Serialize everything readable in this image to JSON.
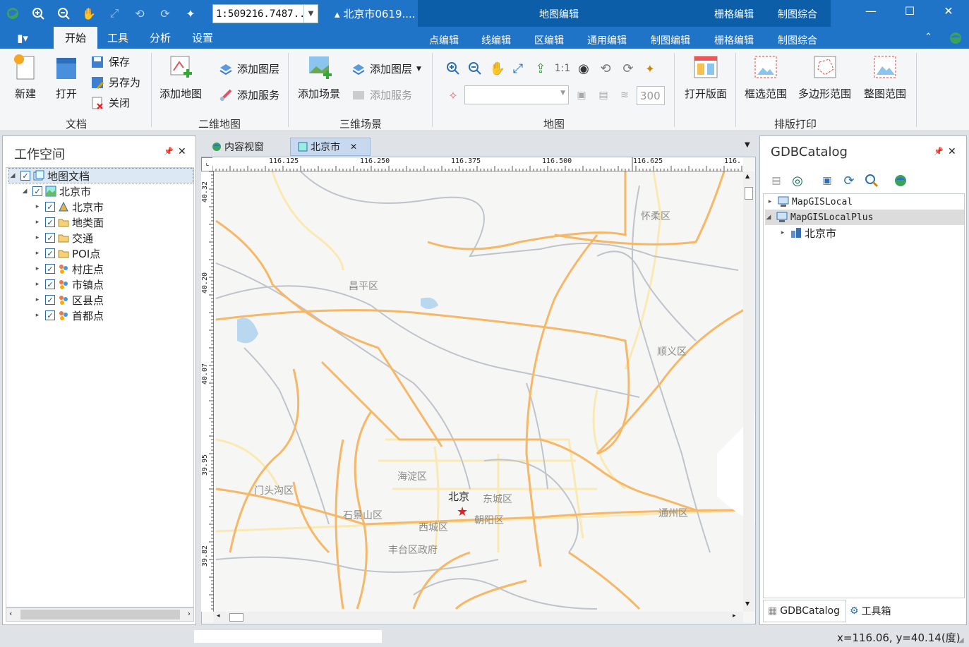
{
  "titlebar": {
    "scale_value": "1:509216.7487...",
    "doc_title": "北京市0619....",
    "ctx_title": "地图编辑",
    "ctx_right_top": [
      "栅格编辑",
      "制图综合"
    ],
    "ctx_tabs": [
      "点编辑",
      "线编辑",
      "区编辑",
      "通用编辑",
      "制图编辑",
      "栅格编辑",
      "制图综合"
    ]
  },
  "tabs": [
    "开始",
    "工具",
    "分析",
    "设置"
  ],
  "ribbon": {
    "doc": {
      "new": "新建",
      "open": "打开",
      "save": "保存",
      "save_as": "另存为",
      "close": "关闭",
      "group": "文档"
    },
    "map2d": {
      "add_map": "添加地图",
      "add_layer": "添加图层",
      "add_service": "添加服务",
      "group": "二维地图"
    },
    "scene3d": {
      "add_scene": "添加场景",
      "add_layer": "添加图层",
      "add_service": "添加服务",
      "group": "三维场景"
    },
    "map": {
      "ratio_label": "1:1",
      "opacity_value": "300",
      "group": "地图"
    },
    "print": {
      "open_layout": "打开版面",
      "box_range": "框选范围",
      "polygon_range": "多边形范围",
      "full_range": "整图范围",
      "group": "排版打印"
    }
  },
  "workspace": {
    "title": "工作空间",
    "root": "地图文档",
    "map": "北京市",
    "layers": [
      "北京市",
      "地类面",
      "交通",
      "POI点",
      "村庄点",
      "市镇点",
      "区县点",
      "首都点"
    ]
  },
  "map_view": {
    "tabs": [
      "内容视窗",
      "北京市"
    ],
    "ruler_top": [
      "116.125",
      "116.250",
      "116.375",
      "116.500",
      "116.625",
      "116."
    ],
    "ruler_left": [
      "40.32",
      "40.20",
      "40.07",
      "39.95",
      "39.82"
    ],
    "labels": {
      "huairou": "怀柔区",
      "changping": "昌平区",
      "shunyi": "顺义区",
      "haidian": "海淀区",
      "mentougou": "门头沟区",
      "beijing": "北京",
      "dongcheng": "东城区",
      "shijingshan": "石景山区",
      "chaoyang": "朝阳区",
      "xicheng": "西城区",
      "tongzhou": "通州区",
      "fengtai": "丰台区政府"
    }
  },
  "catalog": {
    "title": "GDBCatalog",
    "items": [
      "MapGISLocal",
      "MapGISLocalPlus",
      "北京市"
    ],
    "bottom_tabs": [
      "GDBCatalog",
      "工具箱"
    ]
  },
  "status": {
    "coords": "x=116.06, y=40.14(度)"
  }
}
